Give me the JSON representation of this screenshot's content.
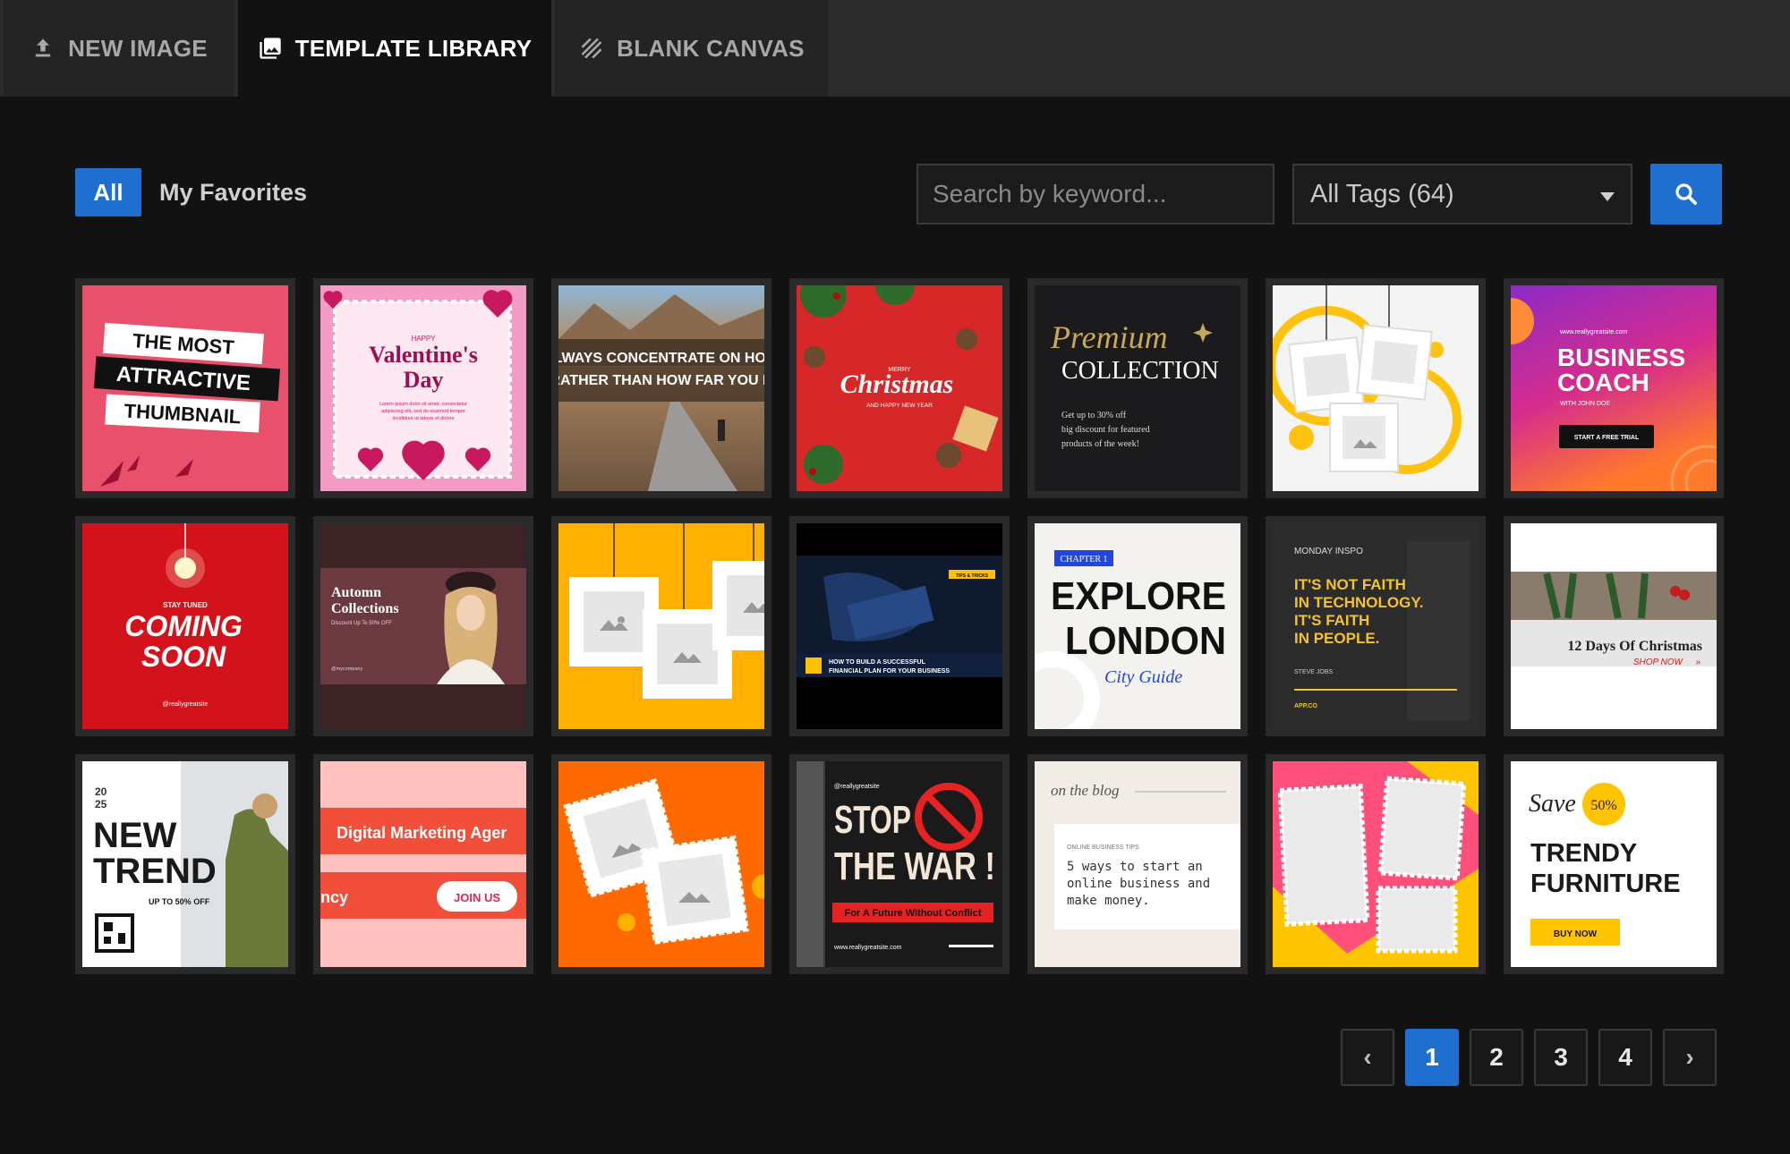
{
  "tabs": [
    {
      "label": "NEW IMAGE",
      "icon": "upload-icon"
    },
    {
      "label": "TEMPLATE LIBRARY",
      "icon": "image-library-icon",
      "active": true
    },
    {
      "label": "BLANK CANVAS",
      "icon": "hatch-icon"
    }
  ],
  "filters": {
    "all_label": "All",
    "favorites_label": "My Favorites"
  },
  "search": {
    "placeholder": "Search by keyword...",
    "value": ""
  },
  "tags_select": {
    "selected": "All Tags (64)"
  },
  "colors": {
    "accent": "#1e6fd0",
    "background": "#121212",
    "tab_bar": "#2b2b2b",
    "card_frame": "#2a2a2a"
  },
  "templates": [
    {
      "id": "t1",
      "lines": [
        "THE MOST",
        "ATTRACTIVE",
        "THUMBNAIL"
      ]
    },
    {
      "id": "t2",
      "lines": [
        "HAPPY",
        "Valentine's",
        "Day",
        "Lorem ipsum dolor sit amet, consectetur",
        "adipiscing elit, sed do eiusmod tempor",
        "incididunt ut labore et dolore"
      ]
    },
    {
      "id": "t3",
      "lines": [
        "ALWAYS CONCENTRATE ON HOW",
        "RATHER THAN HOW FAR YOU H"
      ]
    },
    {
      "id": "t4",
      "lines": [
        "MERRY",
        "Christmas",
        "AND HAPPY NEW YEAR"
      ]
    },
    {
      "id": "t5",
      "lines": [
        "Premium",
        "COLLECTION",
        "Get up to 30% off",
        "big discount for featured",
        "products of the week!"
      ]
    },
    {
      "id": "t6",
      "lines": []
    },
    {
      "id": "t7",
      "lines": [
        "www.reallygreatsite.com",
        "BUSINESS",
        "COACH",
        "WITH JOHN DOE",
        "START A FREE TRIAL"
      ]
    },
    {
      "id": "t8",
      "lines": [
        "STAY TUNED",
        "COMING",
        "SOON",
        "@reallygreatsite"
      ]
    },
    {
      "id": "t9",
      "lines": [
        "Automn",
        "Collections",
        "Discount Up To 50% OFF",
        "@mycompany"
      ]
    },
    {
      "id": "t10",
      "lines": []
    },
    {
      "id": "t11",
      "lines": [
        "TIPS & TRICKS",
        "HOW TO BUILD A SUCCESSFUL",
        "FINANCIAL PLAN FOR YOUR BUSINESS"
      ]
    },
    {
      "id": "t12",
      "lines": [
        "CHAPTER 1",
        "EXPLORE",
        "LONDON",
        "City Guide"
      ]
    },
    {
      "id": "t13",
      "lines": [
        "MONDAY INSPO",
        "IT'S NOT FAITH",
        "IN TECHNOLOGY.",
        "IT'S FAITH",
        "IN PEOPLE.",
        "STEVE JOBS",
        "APP.CO"
      ]
    },
    {
      "id": "t14",
      "lines": [
        "12 Days Of Christmas",
        "SHOP NOW"
      ]
    },
    {
      "id": "t15",
      "lines": [
        "20",
        "25",
        "NEW",
        "TREND",
        "UP TO 50% OFF"
      ]
    },
    {
      "id": "t16",
      "lines": [
        "Digital Marketing Ager",
        "ncy",
        "JOIN US"
      ]
    },
    {
      "id": "t17",
      "lines": []
    },
    {
      "id": "t18",
      "lines": [
        "@reallygreatsite",
        "STOP",
        "THE WAR !",
        "For A Future Without Conflict",
        "www.reallygreatsite.com"
      ]
    },
    {
      "id": "t19",
      "lines": [
        "on the blog",
        "ONLINE BUSINESS TIPS",
        "5 ways to start an",
        "online business and",
        "make money."
      ]
    },
    {
      "id": "t20",
      "lines": []
    },
    {
      "id": "t21",
      "lines": [
        "Save",
        "50%",
        "TRENDY",
        "FURNITURE",
        "BUY NOW"
      ]
    }
  ],
  "pagination": {
    "prev": "‹",
    "pages": [
      "1",
      "2",
      "3",
      "4"
    ],
    "current": "1",
    "next": "›"
  }
}
